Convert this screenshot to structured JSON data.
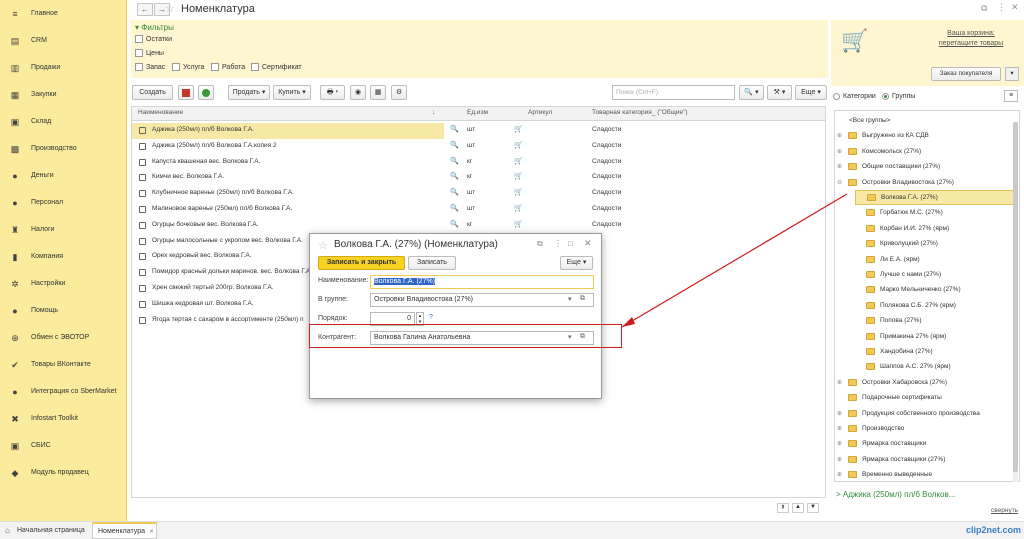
{
  "sidebar": {
    "items": [
      {
        "label": "Главное",
        "icon": "≡"
      },
      {
        "label": "CRM",
        "icon": "▤"
      },
      {
        "label": "Продажи",
        "icon": "▥"
      },
      {
        "label": "Закупки",
        "icon": "▦"
      },
      {
        "label": "Склад",
        "icon": "▣"
      },
      {
        "label": "Производство",
        "icon": "▩"
      },
      {
        "label": "Деньги",
        "icon": "●"
      },
      {
        "label": "Персонал",
        "icon": "●"
      },
      {
        "label": "Налоги",
        "icon": "♜"
      },
      {
        "label": "Компания",
        "icon": "▮"
      },
      {
        "label": "Настройки",
        "icon": "✲"
      },
      {
        "label": "Помощь",
        "icon": "●"
      },
      {
        "label": "Обмен с ЭВОТОР",
        "icon": "⊕"
      },
      {
        "label": "Товары ВКонтакте",
        "icon": "✔"
      },
      {
        "label": "Интеграция со SberMarket",
        "icon": "●"
      },
      {
        "label": "Infostart Toolkit",
        "icon": "✖"
      },
      {
        "label": "СБИС",
        "icon": "▣"
      },
      {
        "label": "Модуль продавец",
        "icon": "◆"
      }
    ]
  },
  "header": {
    "title": "Номенклатура",
    "back": "←",
    "forward": "→"
  },
  "filters": {
    "title": "▾ Фильтры",
    "ostatki": "Остатки",
    "ceny": "Цены",
    "zapas": "Запас",
    "usluga": "Услуга",
    "rabota": "Работа",
    "sertifikat": "Сертификат"
  },
  "toolbar": {
    "create": "Создать",
    "sales": "Продать ▾",
    "buy": "Купить ▾",
    "search_placeholder": "Поиск (Ctrl+F)",
    "more": "Еще ▾"
  },
  "table": {
    "headers": {
      "name": "Наименование",
      "unit": "Ед.изм",
      "article": "Артикул",
      "category": "Товарная категория_ (\"Общие\")"
    },
    "rows": [
      {
        "name": "Аджика (250мл) пл/б Волкова Г.А.",
        "unit": "шт",
        "category": "Сладости"
      },
      {
        "name": "Аджика (250мл) пл/б Волкова Г.А.копия 2",
        "unit": "шт",
        "category": "Сладости"
      },
      {
        "name": "Капуста квашеная вес. Волкова Г.А.",
        "unit": "кг",
        "category": "Сладости"
      },
      {
        "name": "Кимчи вес. Волкова Г.А.",
        "unit": "кг",
        "category": "Сладости"
      },
      {
        "name": "Клубничное варенье (250мл) пл/б Волкова Г.А.",
        "unit": "шт",
        "category": "Сладости"
      },
      {
        "name": "Малиновое варенье (250мл) пл/б Волкова Г.А.",
        "unit": "шт",
        "category": "Сладости"
      },
      {
        "name": "Огурцы бочковые вес. Волкова Г.А.",
        "unit": "кг",
        "category": "Сладости"
      },
      {
        "name": "Огурцы малосольные с укропом вес. Волкова Г.А.",
        "unit": "",
        "category": ""
      },
      {
        "name": "Орех кедровый вес. Волкова Г.А.",
        "unit": "",
        "category": ""
      },
      {
        "name": "Помидор красный дольки маринов. вес. Волкова Г.А.",
        "unit": "",
        "category": ""
      },
      {
        "name": "Хрен свежий тертый 200гр. Волкова Г.А.",
        "unit": "",
        "category": ""
      },
      {
        "name": "Шишка кедровая шт. Волкова Г.А.",
        "unit": "",
        "category": ""
      },
      {
        "name": "Ягода тертая с сахаром в ассортименте (250мл) п",
        "unit": "",
        "category": ""
      }
    ]
  },
  "right": {
    "cart_line1": "Ваша корзина:",
    "cart_line2": "перетащите товары",
    "order_button": "Заказ покупателя",
    "radio_categories": "Категории",
    "radio_groups": "Группы",
    "tree": [
      {
        "label": "<Все группы>",
        "level": 0,
        "folder": false,
        "expander": ""
      },
      {
        "label": "Выгружено из КА СДВ",
        "level": 0,
        "folder": true,
        "expander": "⊕"
      },
      {
        "label": "Комсомольск (27%)",
        "level": 0,
        "folder": true,
        "expander": "⊕"
      },
      {
        "label": "Общие поставщики (27%)",
        "level": 0,
        "folder": true,
        "expander": "⊕"
      },
      {
        "label": "Островки Владивостока (27%)",
        "level": 0,
        "folder": true,
        "expander": "⊖"
      },
      {
        "label": "Волкова Г.А. (27%)",
        "level": 1,
        "folder": true,
        "expander": "",
        "selected": true
      },
      {
        "label": "Горбатюк М.С. (27%)",
        "level": 1,
        "folder": true,
        "expander": ""
      },
      {
        "label": "Корбан И.И. 27% (ярм)",
        "level": 1,
        "folder": true,
        "expander": ""
      },
      {
        "label": "Криволуцкий (27%)",
        "level": 1,
        "folder": true,
        "expander": ""
      },
      {
        "label": "Ли Е.А. (ярм)",
        "level": 1,
        "folder": true,
        "expander": ""
      },
      {
        "label": "Лучше с нами (27%)",
        "level": 1,
        "folder": true,
        "expander": ""
      },
      {
        "label": "Марко Мельниченко (27%)",
        "level": 1,
        "folder": true,
        "expander": ""
      },
      {
        "label": "Полякова С.Б. 27% (ярм)",
        "level": 1,
        "folder": true,
        "expander": ""
      },
      {
        "label": "Попова (27%)",
        "level": 1,
        "folder": true,
        "expander": ""
      },
      {
        "label": "Примакина 27% (ярм)",
        "level": 1,
        "folder": true,
        "expander": ""
      },
      {
        "label": "Хандобина (27%)",
        "level": 1,
        "folder": true,
        "expander": ""
      },
      {
        "label": "Шаппов А.С. 27% (ярм)",
        "level": 1,
        "folder": true,
        "expander": ""
      },
      {
        "label": "Островки Хабаровска (27%)",
        "level": 0,
        "folder": true,
        "expander": "⊕"
      },
      {
        "label": "Подарочные сертификаты",
        "level": 0,
        "folder": true,
        "expander": ""
      },
      {
        "label": "Продукция собственного производства",
        "level": 0,
        "folder": true,
        "expander": "⊕"
      },
      {
        "label": "Производство",
        "level": 0,
        "folder": true,
        "expander": "⊕"
      },
      {
        "label": "Ярмарка поставщики",
        "level": 0,
        "folder": true,
        "expander": "⊕"
      },
      {
        "label": "Ярмарка поставщики (27%)",
        "level": 0,
        "folder": true,
        "expander": "⊕"
      },
      {
        "label": "Временно выведенные",
        "level": 0,
        "folder": true,
        "expander": "⊕"
      }
    ],
    "bottom_link": "> Аджика (250мл) пл/б Волков...",
    "collapse_link": "свернуть"
  },
  "dialog": {
    "title": "Волкова Г.А. (27%) (Номенклатура)",
    "save_close": "Записать и закрыть",
    "save": "Записать",
    "more": "Еще ▾",
    "name_label": "Наименование:",
    "name_value": "Волкова Г.А. (27%)",
    "group_label": "В группе:",
    "group_value": "Островки Владивостока (27%)",
    "order_label": "Порядок:",
    "order_value": "0",
    "help": "?",
    "contractor_label": "Контрагент:",
    "contractor_value": "Волкова Галина Анатольевна"
  },
  "statusbar": {
    "home": "Начальная страница",
    "tab": "Номенклатура",
    "logo": "clip2net.com"
  },
  "colors": {
    "sidebar": "#fbeb9c",
    "accent_yellow": "#f6d223",
    "selection": "#f8e8a5",
    "annotation_red": "#d11c1c",
    "link_green": "#2e8b3a"
  }
}
